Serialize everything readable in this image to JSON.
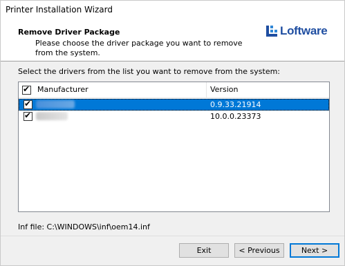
{
  "window": {
    "title": "Printer Installation Wizard"
  },
  "header": {
    "title": "Remove Driver Package",
    "description": "Please choose the driver package you want to remove from the system.",
    "logo_text": "Loftware",
    "logo_color": "#1f4ea1"
  },
  "instruction": "Select the drivers from the list you want to remove from the system:",
  "table": {
    "columns": [
      "Manufacturer",
      "Version"
    ],
    "header_checked": true,
    "rows": [
      {
        "manufacturer": "",
        "version": "0.9.33.21914",
        "checked": true,
        "selected": true
      },
      {
        "manufacturer": "",
        "version": "10.0.0.23373",
        "checked": true,
        "selected": false
      }
    ]
  },
  "inf_file": "Inf file: C:\\WINDOWS\\inf\\oem14.inf",
  "buttons": {
    "exit": "Exit",
    "previous": "< Previous",
    "next": "Next >"
  },
  "colors": {
    "selection": "#0078d7",
    "primary_border": "#0078d7"
  }
}
